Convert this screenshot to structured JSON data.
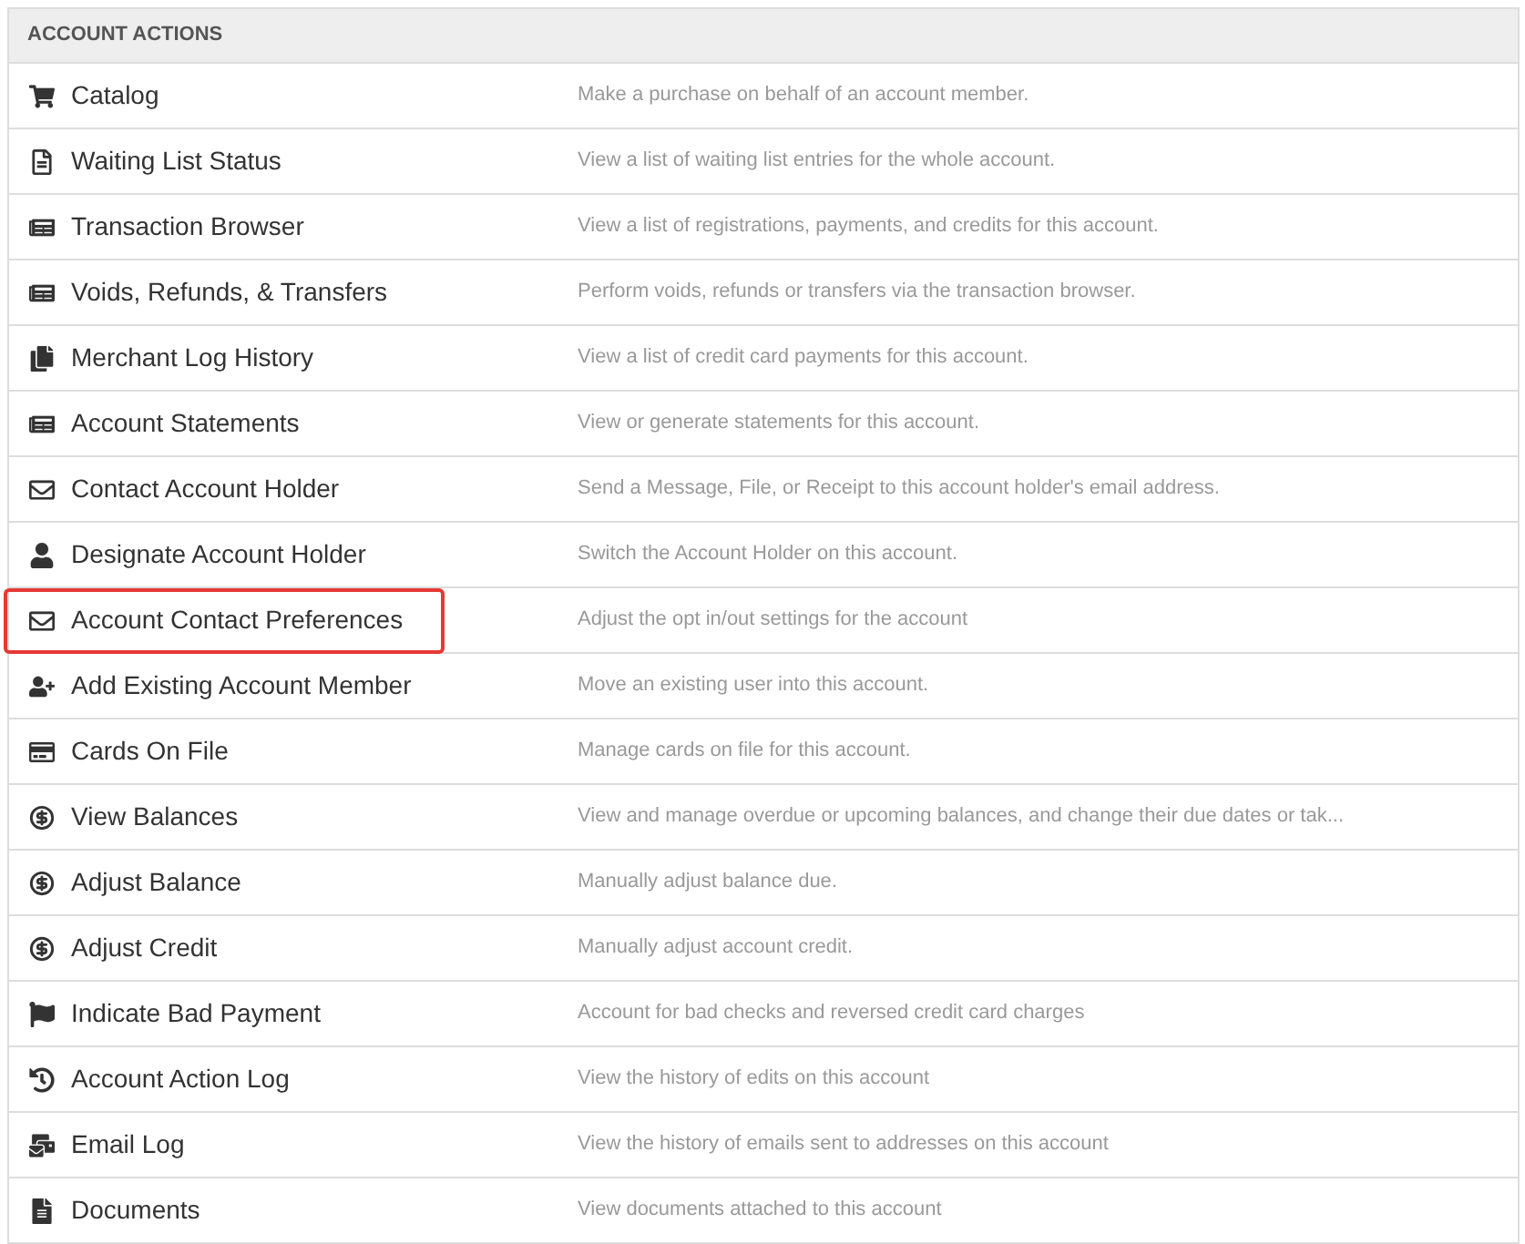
{
  "header": "ACCOUNT ACTIONS",
  "rows": [
    {
      "label": "Catalog",
      "description": "Make a purchase on behalf of an account member.",
      "highlighted": false
    },
    {
      "label": "Waiting List Status",
      "description": "View a list of waiting list entries for the whole account.",
      "highlighted": false
    },
    {
      "label": "Transaction Browser",
      "description": "View a list of registrations, payments, and credits for this account.",
      "highlighted": false
    },
    {
      "label": "Voids, Refunds, & Transfers",
      "description": "Perform voids, refunds or transfers via the transaction browser.",
      "highlighted": false
    },
    {
      "label": "Merchant Log History",
      "description": "View a list of credit card payments for this account.",
      "highlighted": false
    },
    {
      "label": "Account Statements",
      "description": "View or generate statements for this account.",
      "highlighted": false
    },
    {
      "label": "Contact Account Holder",
      "description": "Send a Message, File, or Receipt to this account holder's email address.",
      "highlighted": false
    },
    {
      "label": "Designate Account Holder",
      "description": "Switch the Account Holder on this account.",
      "highlighted": false
    },
    {
      "label": "Account Contact Preferences",
      "description": "Adjust the opt in/out settings for the account",
      "highlighted": true
    },
    {
      "label": "Add Existing Account Member",
      "description": "Move an existing user into this account.",
      "highlighted": false
    },
    {
      "label": "Cards On File",
      "description": "Manage cards on file for this account.",
      "highlighted": false
    },
    {
      "label": "View Balances",
      "description": "View and manage overdue or upcoming balances, and change their due dates or tak...",
      "highlighted": false
    },
    {
      "label": "Adjust Balance",
      "description": "Manually adjust balance due.",
      "highlighted": false
    },
    {
      "label": "Adjust Credit",
      "description": "Manually adjust account credit.",
      "highlighted": false
    },
    {
      "label": "Indicate Bad Payment",
      "description": "Account for bad checks and reversed credit card charges",
      "highlighted": false
    },
    {
      "label": "Account Action Log",
      "description": "View the history of edits on this account",
      "highlighted": false
    },
    {
      "label": "Email Log",
      "description": "View the history of emails sent to addresses on this account",
      "highlighted": false
    },
    {
      "label": "Documents",
      "description": "View documents attached to this account",
      "highlighted": false
    }
  ]
}
